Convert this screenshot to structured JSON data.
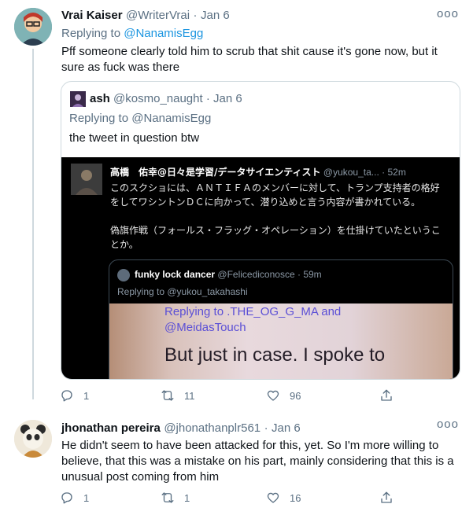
{
  "tweet1": {
    "name": "Vrai Kaiser",
    "handle": "@WriterVrai",
    "dot": "·",
    "date": "Jan 6",
    "more": "ooo",
    "replying_prefix": "Replying to",
    "replying_to": "@NanamisEgg",
    "text": "Pff someone clearly told him to scrub that shit cause it's gone now, but it sure as fuck was there",
    "quote": {
      "name": "ash",
      "handle": "@kosmo_naught",
      "dot": "·",
      "date": "Jan 6",
      "replying_prefix": "Replying to",
      "replying_to": "@NanamisEgg",
      "text": "the tweet in question btw",
      "screenshot": {
        "name": "高橋　佑幸@日々是学習/データサイエンティスト",
        "handle": "@yukou_ta...",
        "dot": "·",
        "date": "52m",
        "para1": "このスクショには、ＡＮＴＩＦＡのメンバーに対して、トランプ支持者の格好をしてワシントンＤＣに向かって、潜り込めと言う内容が書かれている。",
        "para2": "偽旗作戦（フォールス・フラッグ・オペレーション）を仕掛けていたということか。",
        "inner": {
          "name": "funky lock dancer",
          "handle": "@Felicediconosce",
          "dot": "·",
          "date": "59m",
          "replying": "Replying to @yukou_takahashi",
          "photo_line1": "Replying to .THE_OG_G_MA and",
          "photo_line2": "@MeidasTouch",
          "photo_line3": "But just in case. I spoke to"
        }
      }
    },
    "counts": {
      "replies": "1",
      "retweets": "11",
      "likes": "96"
    }
  },
  "tweet2": {
    "name": "jhonathan pereira",
    "handle": "@jhonathanplr561",
    "dot": "·",
    "date": "Jan 6",
    "more": "ooo",
    "text": "He didn't seem to have been attacked for this, yet. So I'm more willing to believe, that this was a mistake on his part, mainly considering that this is a unusual post coming from him",
    "counts": {
      "replies": "1",
      "retweets": "1",
      "likes": "16"
    }
  },
  "colors": {
    "link": "#1b95e0",
    "muted": "#5b7083",
    "border": "#cfd9de"
  }
}
